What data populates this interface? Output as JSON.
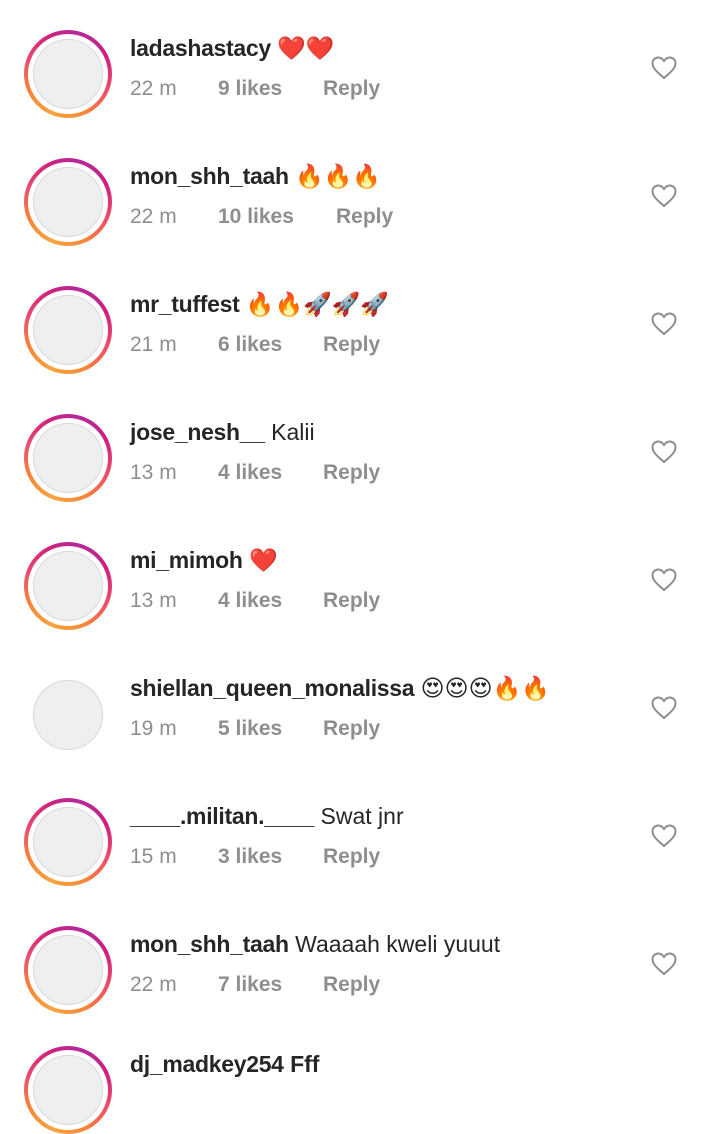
{
  "comments": [
    {
      "username": "ladashastacy",
      "text": "❤️❤️",
      "time": "22 m",
      "likes": "9 likes",
      "reply": "Reply",
      "story_ring": true
    },
    {
      "username": "mon_shh_taah",
      "text": "🔥🔥🔥",
      "time": "22 m",
      "likes": "10 likes",
      "reply": "Reply",
      "story_ring": true
    },
    {
      "username": "mr_tuffest",
      "text": "🔥🔥🚀🚀🚀",
      "time": "21 m",
      "likes": "6 likes",
      "reply": "Reply",
      "story_ring": true
    },
    {
      "username": "jose_nesh__",
      "text": "Kalii",
      "time": "13 m",
      "likes": "4 likes",
      "reply": "Reply",
      "story_ring": true
    },
    {
      "username": "mi_mimoh",
      "text": "❤️",
      "time": "13 m",
      "likes": "4 likes",
      "reply": "Reply",
      "story_ring": true
    },
    {
      "username": "shiellan_queen_monalissa",
      "text": "😍😍😍🔥🔥",
      "time": "19 m",
      "likes": "5 likes",
      "reply": "Reply",
      "story_ring": false
    },
    {
      "username": "____.militan.____",
      "text": "Swat jnr",
      "time": "15 m",
      "likes": "3 likes",
      "reply": "Reply",
      "story_ring": true
    },
    {
      "username": "mon_shh_taah",
      "text": "Waaaah kweli yuuut",
      "time": "22 m",
      "likes": "7 likes",
      "reply": "Reply",
      "story_ring": true
    }
  ],
  "partial_comment": {
    "username": "dj_madkey254",
    "text": "Fff"
  },
  "colors": {
    "text_primary": "#262626",
    "text_secondary": "#8e8e8e",
    "ring_start": "#f9a43a",
    "ring_end": "#b22a9a"
  },
  "icons": {
    "like": "heart-outline-icon"
  }
}
